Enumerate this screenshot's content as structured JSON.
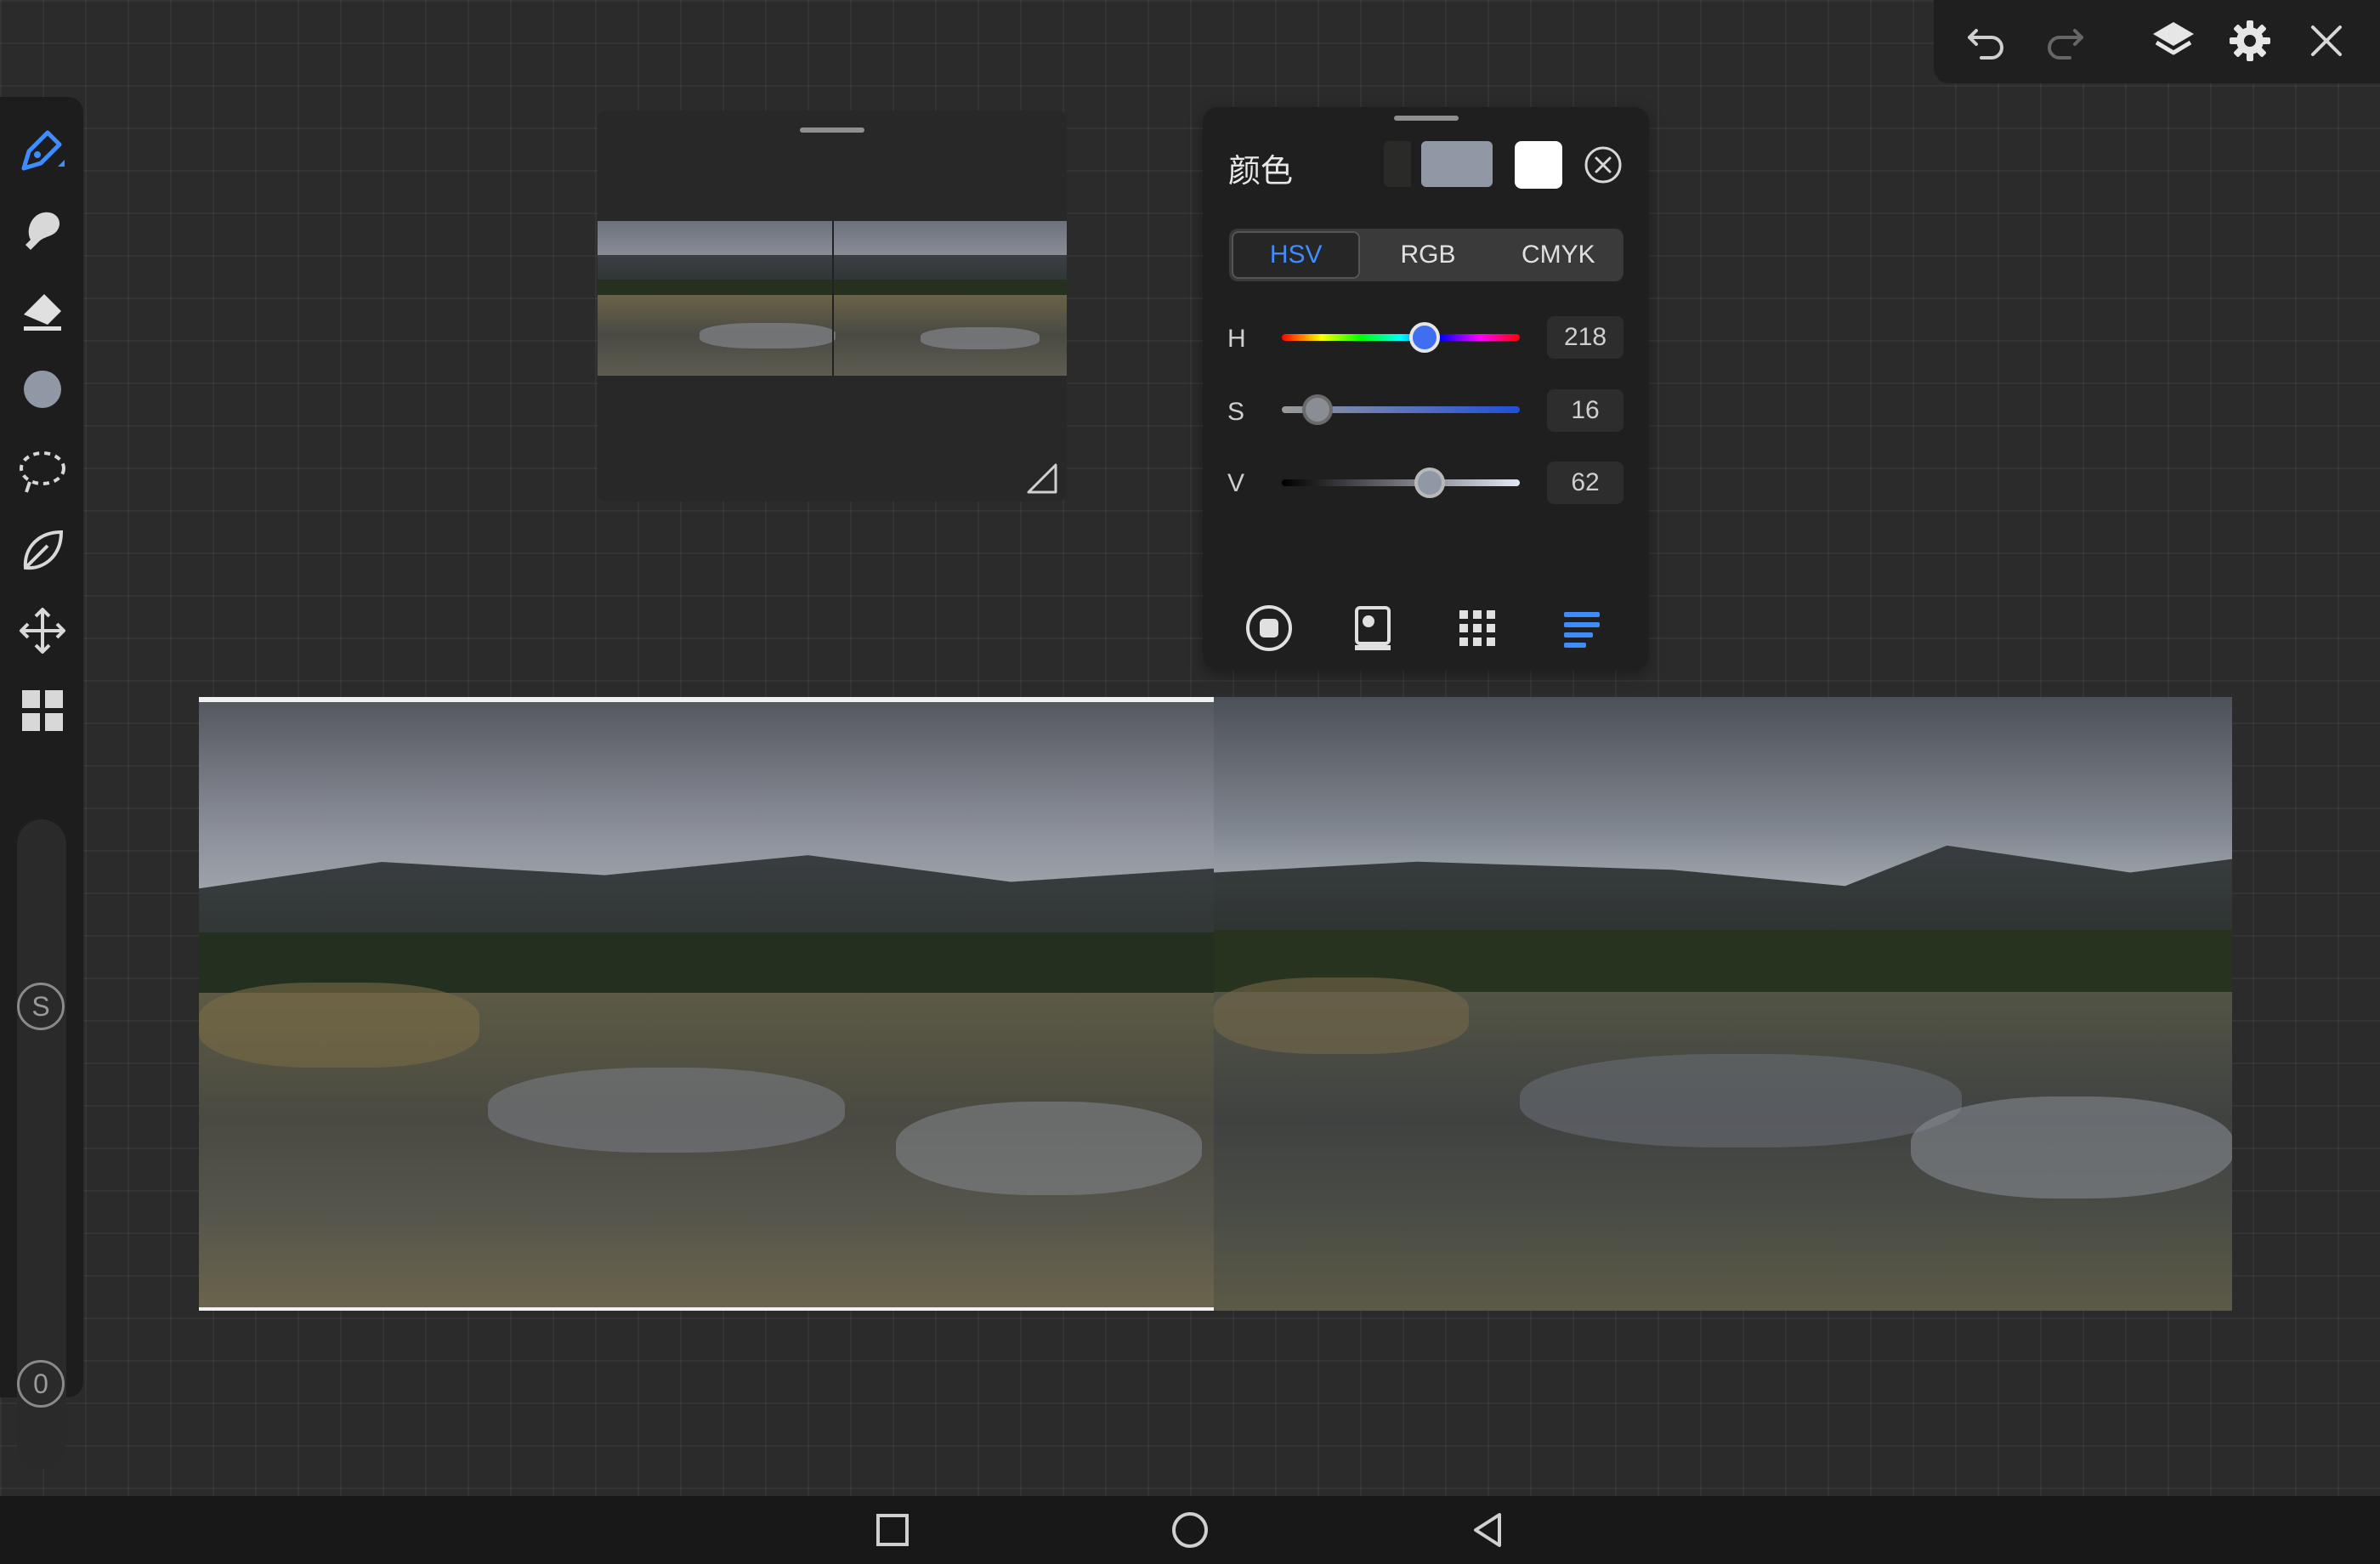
{
  "top_toolbar": {
    "icons": [
      "undo-icon",
      "redo-icon",
      "layers-icon",
      "gear-icon",
      "close-icon"
    ]
  },
  "left_toolbar": {
    "tools": [
      "pen-icon",
      "smudge-icon",
      "eraser-icon",
      "color-dot-icon",
      "lasso-icon",
      "leaf-icon",
      "move-icon",
      "grid-icon"
    ],
    "size_slider_label": "S",
    "opacity_slider_label": "0"
  },
  "color_panel": {
    "title": "颜色",
    "primary_color": "#9098a6",
    "secondary_color": "#ffffff",
    "tabs": [
      "HSV",
      "RGB",
      "CMYK"
    ],
    "active_tab": "HSV",
    "sliders": [
      {
        "label": "H",
        "value": "218"
      },
      {
        "label": "S",
        "value": "16"
      },
      {
        "label": "V",
        "value": "62"
      }
    ],
    "bottom_icons": [
      "disc-icon",
      "palette-card-icon",
      "swatch-grid-icon",
      "list-icon"
    ]
  },
  "canvas": {
    "layers": [
      "reference-photo",
      "painted-study"
    ]
  },
  "nav_bar": {
    "icons": [
      "recent-apps-icon",
      "home-icon",
      "back-icon"
    ]
  },
  "colors": {
    "accent": "#3f8cff",
    "background": "#2b2b2b"
  }
}
